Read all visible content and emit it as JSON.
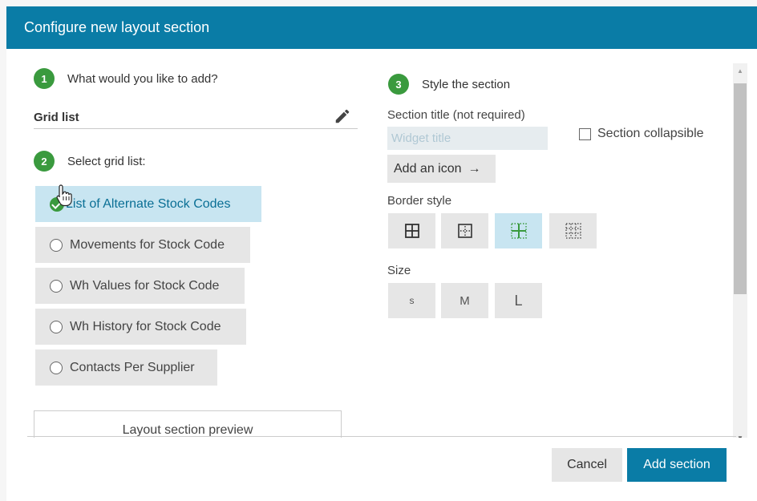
{
  "dialog": {
    "title": "Configure new layout section"
  },
  "step1": {
    "number": "1",
    "label": "What would you like to add?"
  },
  "grid_list": {
    "label": "Grid list"
  },
  "step2": {
    "number": "2",
    "label": "Select grid list:"
  },
  "options": [
    {
      "label": "List of Alternate Stock Codes",
      "selected": true
    },
    {
      "label": "Movements for Stock Code",
      "selected": false
    },
    {
      "label": "Wh Values for Stock Code",
      "selected": false
    },
    {
      "label": "Wh History for Stock Code",
      "selected": false
    },
    {
      "label": "Contacts Per Supplier",
      "selected": false
    }
  ],
  "preview": {
    "label": "Layout section preview"
  },
  "step3": {
    "number": "3",
    "label": "Style the section"
  },
  "section_title": {
    "label": "Section title (not required)",
    "placeholder": "Widget title",
    "value": ""
  },
  "collapsible": {
    "label": "Section collapsible",
    "checked": false
  },
  "add_icon": {
    "label": "Add an icon",
    "arrow": "→"
  },
  "border_style": {
    "label": "Border style",
    "options": [
      "all-borders",
      "inner-dotted",
      "inner-lines",
      "all-dotted"
    ],
    "selected": "inner-lines"
  },
  "size": {
    "label": "Size",
    "options": [
      "S",
      "M",
      "L"
    ]
  },
  "footer": {
    "cancel": "Cancel",
    "add": "Add section"
  },
  "colors": {
    "header": "#0a7ca6",
    "step_badge": "#3a9a3e",
    "selected_bg": "#c8e5f1"
  }
}
